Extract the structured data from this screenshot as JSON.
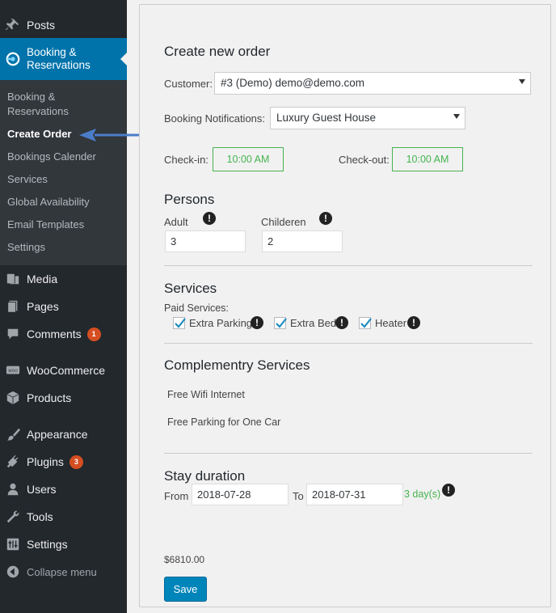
{
  "sidebar": {
    "items": [
      {
        "key": "posts",
        "label": "Posts",
        "icon": "pin-icon"
      },
      {
        "key": "booking",
        "label_line1": "Booking &",
        "label_line2": "Reservations",
        "icon": "booking-icon"
      },
      {
        "key": "media",
        "label": "Media",
        "icon": "media-icon"
      },
      {
        "key": "pages",
        "label": "Pages",
        "icon": "pages-icon"
      },
      {
        "key": "comments",
        "label": "Comments",
        "icon": "comment-icon",
        "badge": "1"
      },
      {
        "key": "woocommerce",
        "label": "WooCommerce",
        "icon": "woo-icon"
      },
      {
        "key": "products",
        "label": "Products",
        "icon": "box-icon"
      },
      {
        "key": "appearance",
        "label": "Appearance",
        "icon": "brush-icon"
      },
      {
        "key": "plugins",
        "label": "Plugins",
        "icon": "plug-icon",
        "badge": "3"
      },
      {
        "key": "users",
        "label": "Users",
        "icon": "user-icon"
      },
      {
        "key": "tools",
        "label": "Tools",
        "icon": "wrench-icon"
      },
      {
        "key": "settings",
        "label": "Settings",
        "icon": "settings-icon"
      },
      {
        "key": "collapse",
        "label": "Collapse menu",
        "icon": "collapse-icon"
      }
    ],
    "submenu": [
      {
        "label_line1": "Booking &",
        "label_line2": "Reservations"
      },
      {
        "label": "Create Order",
        "current": true
      },
      {
        "label": "Bookings Calender"
      },
      {
        "label": "Services"
      },
      {
        "label": "Global Availability"
      },
      {
        "label": "Email Templates"
      },
      {
        "label": "Settings"
      }
    ]
  },
  "form": {
    "title": "Create new order",
    "customer_label": "Customer:",
    "customer_value": "#3 (Demo) demo@demo.com",
    "notifications_label": "Booking Notifications:",
    "notifications_value": "Luxury Guest House",
    "checkin_label": "Check-in:",
    "checkin_value": "10:00 AM",
    "checkout_label": "Check-out:",
    "checkout_value": "10:00 AM",
    "persons_title": "Persons",
    "adult_label": "Adult",
    "adult_value": "3",
    "children_label": "Childeren",
    "children_value": "2",
    "services_title": "Services",
    "paid_label": "Paid Services:",
    "paid_services": [
      "Extra Parking",
      "Extra Bed",
      "Heater"
    ],
    "comp_title": "Complementry Services",
    "comp_services": [
      "Free Wifi Internet",
      "Free Parking for One Car"
    ],
    "stay_title": "Stay duration",
    "from_label": "From",
    "from_value": "2018-07-28",
    "to_label": "To",
    "to_value": "2018-07-31",
    "days_text": "3 day(s)",
    "total": "$6810.00",
    "save_label": "Save",
    "info_glyph": "!"
  },
  "colors": {
    "accent": "#0073aa",
    "success": "#46b450",
    "badge": "#d54e21",
    "sidebar_bg": "#23282d",
    "arrow": "#4a7dc9"
  }
}
